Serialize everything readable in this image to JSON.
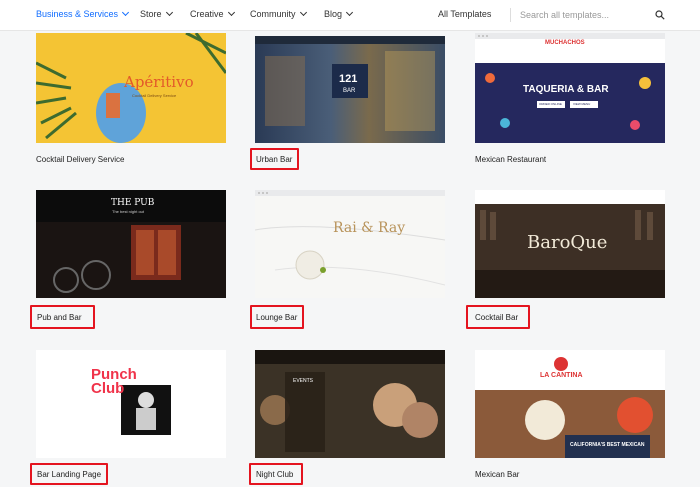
{
  "nav": {
    "items": [
      {
        "label": "Business & Services",
        "active": true
      },
      {
        "label": "Store",
        "active": false
      },
      {
        "label": "Creative",
        "active": false
      },
      {
        "label": "Community",
        "active": false
      },
      {
        "label": "Blog",
        "active": false
      }
    ],
    "all_templates": "All Templates",
    "search_placeholder": "Search all templates..."
  },
  "cards": [
    {
      "label": "Cocktail Delivery Service",
      "highlighted": false,
      "thumb_title": "Apéritivo",
      "thumb_subtitle": "Cocktail Delivery Service"
    },
    {
      "label": "Urban Bar",
      "highlighted": true,
      "thumb_title": "121",
      "thumb_subtitle": "BAR"
    },
    {
      "label": "Mexican Restaurant",
      "highlighted": false,
      "thumb_brand": "MUCHACHOS",
      "thumb_title": "TAQUERIA & BAR",
      "thumb_btn1": "ORDER ONLINE",
      "thumb_btn2": "VIEW MENU"
    },
    {
      "label": "Pub and Bar",
      "highlighted": true,
      "thumb_title": "THE PUB",
      "thumb_subtitle": "The best night out"
    },
    {
      "label": "Lounge Bar",
      "highlighted": true,
      "thumb_title": "Rai & Ray"
    },
    {
      "label": "Cocktail Bar",
      "highlighted": true,
      "thumb_title": "BaroQue"
    },
    {
      "label": "Bar Landing Page",
      "highlighted": true,
      "thumb_title": "Punch Club"
    },
    {
      "label": "Night Club",
      "highlighted": true,
      "thumb_title": "EVENTS"
    },
    {
      "label": "Mexican Bar",
      "highlighted": false,
      "thumb_title": "LA CANTINA",
      "thumb_subtitle": "CALIFORNIA'S BEST MEXICAN"
    }
  ],
  "colors": {
    "accent": "#116dff",
    "highlight": "#e4141f"
  }
}
